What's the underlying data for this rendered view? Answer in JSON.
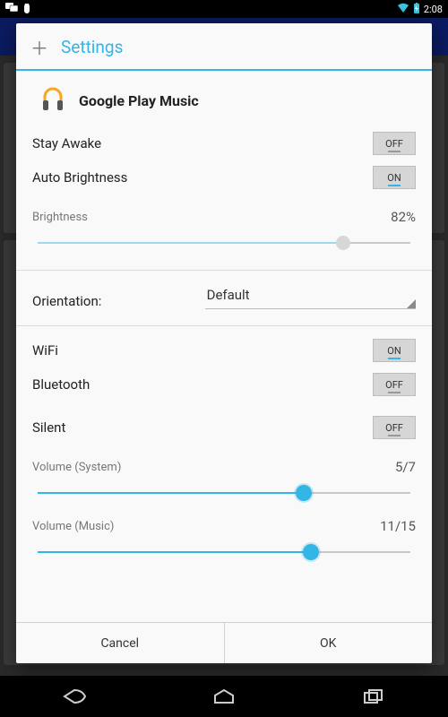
{
  "statusbar": {
    "time": "2:08"
  },
  "dialog": {
    "title": "Settings",
    "app_name": "Google Play Music",
    "stay_awake": {
      "label": "Stay Awake",
      "state": "OFF"
    },
    "auto_brightness": {
      "label": "Auto Brightness",
      "state": "ON"
    },
    "brightness": {
      "label": "Brightness",
      "value_text": "82%",
      "percent": 82
    },
    "orientation": {
      "label": "Orientation:",
      "value": "Default"
    },
    "wifi": {
      "label": "WiFi",
      "state": "ON"
    },
    "bluetooth": {
      "label": "Bluetooth",
      "state": "OFF"
    },
    "silent": {
      "label": "Silent",
      "state": "OFF"
    },
    "volume_system": {
      "label": "Volume (System)",
      "value_text": "5/7",
      "num": 5,
      "den": 7
    },
    "volume_music": {
      "label": "Volume (Music)",
      "value_text": "11/15",
      "num": 11,
      "den": 15
    },
    "buttons": {
      "cancel": "Cancel",
      "ok": "OK"
    }
  },
  "chart_data": {
    "type": "table",
    "title": "App setting values",
    "rows": [
      {
        "setting": "Stay Awake",
        "value": "OFF"
      },
      {
        "setting": "Auto Brightness",
        "value": "ON"
      },
      {
        "setting": "Brightness",
        "value": "82%"
      },
      {
        "setting": "Orientation",
        "value": "Default"
      },
      {
        "setting": "WiFi",
        "value": "ON"
      },
      {
        "setting": "Bluetooth",
        "value": "OFF"
      },
      {
        "setting": "Silent",
        "value": "OFF"
      },
      {
        "setting": "Volume (System)",
        "value": "5/7"
      },
      {
        "setting": "Volume (Music)",
        "value": "11/15"
      }
    ]
  }
}
